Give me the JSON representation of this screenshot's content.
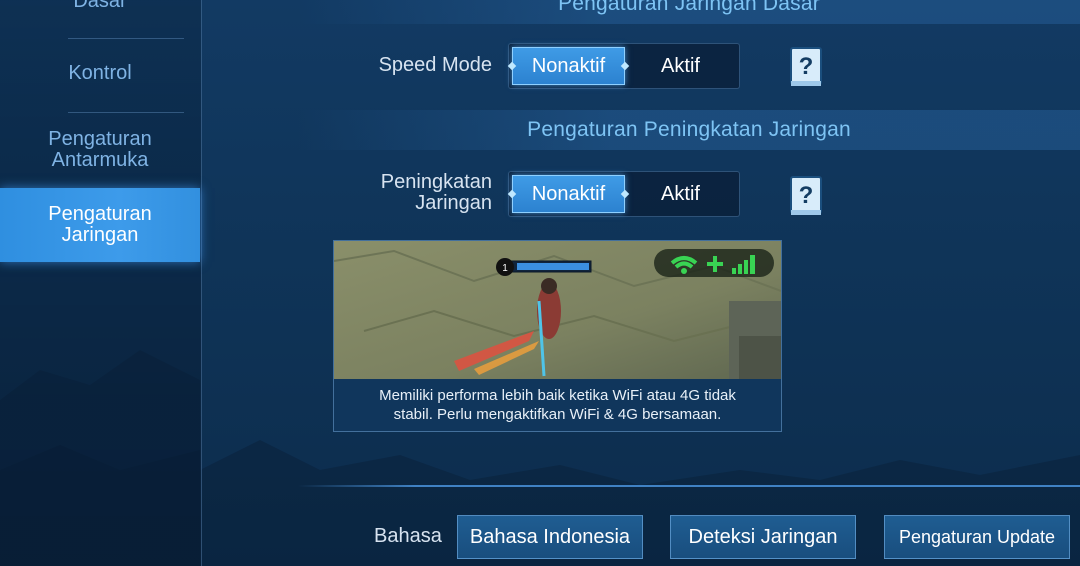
{
  "sidebar": {
    "items": [
      {
        "label": "Dasar"
      },
      {
        "label": "Kontrol"
      },
      {
        "label": "Pengaturan Antarmuka"
      },
      {
        "label": "Pengaturan Jaringan",
        "active": true
      }
    ]
  },
  "sections": {
    "basic_title": "Pengaturan Jaringan Dasar",
    "boost_title": "Pengaturan Peningkatan Jaringan"
  },
  "speed_mode": {
    "label": "Speed Mode",
    "options": [
      "Nonaktif",
      "Aktif"
    ],
    "selected": "Nonaktif"
  },
  "network_boost": {
    "label_line1": "Peningkatan",
    "label_line2": "Jaringan",
    "options": [
      "Nonaktif",
      "Aktif"
    ],
    "selected": "Nonaktif"
  },
  "preview": {
    "level_badge": "1",
    "description_line1": "Memiliki performa lebih baik ketika WiFi atau 4G tidak",
    "description_line2": "stabil. Perlu mengaktifkan WiFi & 4G bersamaan.",
    "icons": [
      "wifi-icon",
      "plus-icon",
      "cellular-signal-icon"
    ]
  },
  "bottom": {
    "language_label": "Bahasa",
    "language_button": "Bahasa Indonesia",
    "detect_button": "Deteksi Jaringan",
    "update_button": "Pengaturan Update"
  },
  "colors": {
    "accent": "#3d9bea",
    "header_text": "#7ec4f4",
    "signal_green": "#39d353"
  }
}
